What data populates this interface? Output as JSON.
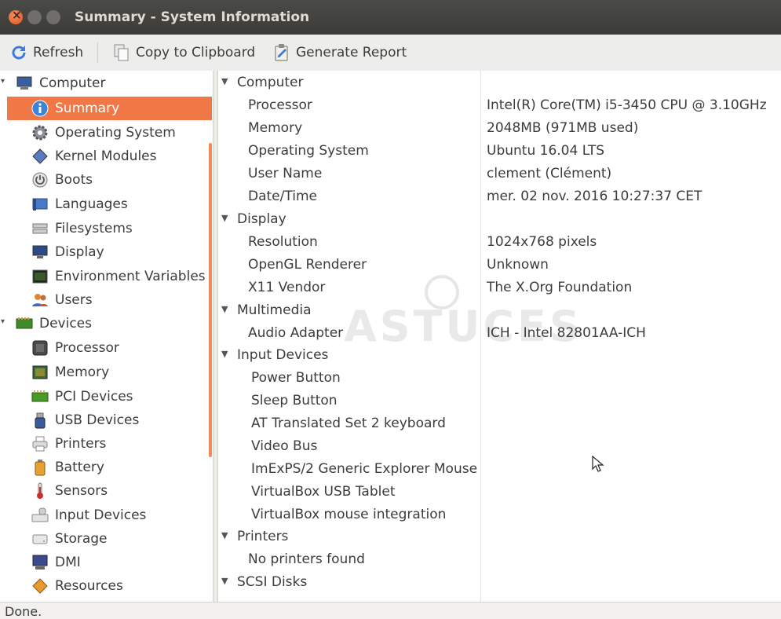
{
  "window": {
    "title": "Summary - System Information"
  },
  "toolbar": {
    "refresh": "Refresh",
    "copy": "Copy to Clipboard",
    "report": "Generate Report"
  },
  "sidebar": {
    "items": [
      {
        "label": "Computer",
        "icon": "monitor-icon"
      },
      {
        "label": "Summary",
        "icon": "info-icon",
        "selected": true
      },
      {
        "label": "Operating System",
        "icon": "gear-icon"
      },
      {
        "label": "Kernel Modules",
        "icon": "module-icon"
      },
      {
        "label": "Boots",
        "icon": "power-icon"
      },
      {
        "label": "Languages",
        "icon": "flag-icon"
      },
      {
        "label": "Filesystems",
        "icon": "drive-icon"
      },
      {
        "label": "Display",
        "icon": "display-icon"
      },
      {
        "label": "Environment Variables",
        "icon": "terminal-icon"
      },
      {
        "label": "Users",
        "icon": "users-icon"
      },
      {
        "label": "Devices",
        "icon": "chip-icon"
      },
      {
        "label": "Processor",
        "icon": "cpu-icon"
      },
      {
        "label": "Memory",
        "icon": "memory-icon"
      },
      {
        "label": "PCI Devices",
        "icon": "pci-icon"
      },
      {
        "label": "USB Devices",
        "icon": "usb-icon"
      },
      {
        "label": "Printers",
        "icon": "printer-icon"
      },
      {
        "label": "Battery",
        "icon": "battery-icon"
      },
      {
        "label": "Sensors",
        "icon": "thermometer-icon"
      },
      {
        "label": "Input Devices",
        "icon": "keyboard-icon"
      },
      {
        "label": "Storage",
        "icon": "storage-icon"
      },
      {
        "label": "DMI",
        "icon": "dmi-icon"
      },
      {
        "label": "Resources",
        "icon": "resources-icon"
      }
    ]
  },
  "content": {
    "rows": [
      {
        "type": "section",
        "key": "Computer"
      },
      {
        "type": "item",
        "key": "Processor",
        "value": "Intel(R) Core(TM) i5-3450 CPU @ 3.10GHz"
      },
      {
        "type": "item",
        "key": "Memory",
        "value": "2048MB (971MB used)"
      },
      {
        "type": "item",
        "key": "Operating System",
        "value": "Ubuntu 16.04 LTS"
      },
      {
        "type": "item",
        "key": "User Name",
        "value": "clement (Clément)"
      },
      {
        "type": "item",
        "key": "Date/Time",
        "value": "mer. 02 nov. 2016 10:27:37 CET"
      },
      {
        "type": "section",
        "key": "Display"
      },
      {
        "type": "item",
        "key": "Resolution",
        "value": "1024x768 pixels"
      },
      {
        "type": "item",
        "key": "OpenGL Renderer",
        "value": "Unknown"
      },
      {
        "type": "item",
        "key": "X11 Vendor",
        "value": "The X.Org Foundation"
      },
      {
        "type": "section",
        "key": "Multimedia"
      },
      {
        "type": "item",
        "key": "Audio Adapter",
        "value": "ICH - Intel 82801AA-ICH"
      },
      {
        "type": "section",
        "key": "Input Devices"
      },
      {
        "type": "item",
        "key": "Power Button",
        "value": ""
      },
      {
        "type": "item",
        "key": "Sleep Button",
        "value": ""
      },
      {
        "type": "item",
        "key": "AT Translated Set 2 keyboard",
        "value": ""
      },
      {
        "type": "item",
        "key": "Video Bus",
        "value": ""
      },
      {
        "type": "item",
        "key": "ImExPS/2 Generic Explorer Mouse",
        "value": ""
      },
      {
        "type": "item",
        "key": "VirtualBox USB Tablet",
        "value": ""
      },
      {
        "type": "item",
        "key": "VirtualBox mouse integration",
        "value": ""
      },
      {
        "type": "section",
        "key": "Printers"
      },
      {
        "type": "item",
        "key": "No printers found",
        "value": ""
      },
      {
        "type": "section",
        "key": "SCSI Disks"
      }
    ]
  },
  "watermark": {
    "text": "ASTUCES"
  },
  "status": {
    "text": "Done."
  },
  "colors": {
    "accent": "#f07746",
    "titlebar": "#3c3b37"
  }
}
